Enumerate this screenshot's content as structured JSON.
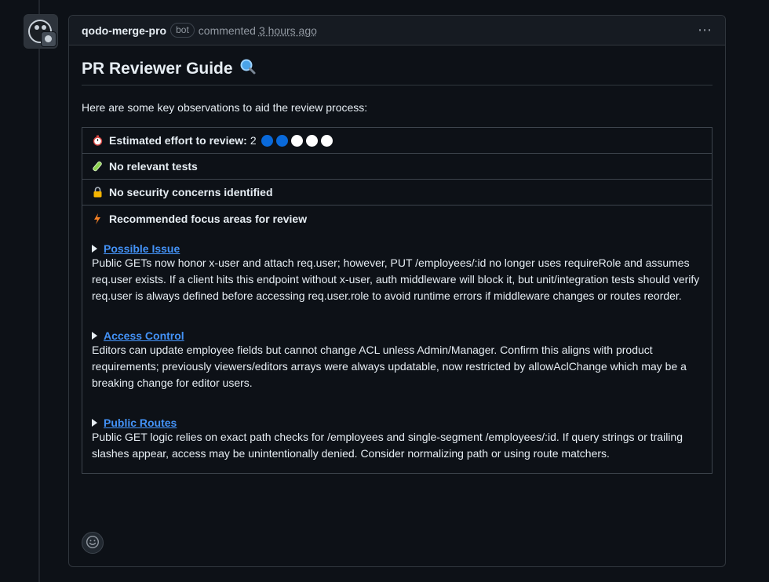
{
  "comment": {
    "author": "qodo-merge-pro",
    "badge": "bot",
    "action": "commented",
    "timestamp": "3 hours ago",
    "more_icon": "kebab-horizontal-icon"
  },
  "guide": {
    "title": "PR Reviewer Guide",
    "title_icon": "magnifier-icon",
    "intro": "Here are some key observations to aid the review process:",
    "effort": {
      "label": "Estimated effort to review:",
      "value": "2",
      "filled": 2,
      "total": 5,
      "filled_color": "#0969da",
      "empty_color": "#ffffff",
      "icon": "stopwatch-icon"
    },
    "tests": {
      "label": "No relevant tests",
      "icon": "test-tube-icon"
    },
    "security": {
      "label": "No security concerns identified",
      "icon": "lock-icon"
    },
    "focus": {
      "label": "Recommended focus areas for review",
      "icon": "lightning-icon",
      "items": [
        {
          "title": "Possible Issue",
          "text": "Public GETs now honor x-user and attach req.user; however, PUT /employees/:id no longer uses requireRole and assumes req.user exists. If a client hits this endpoint without x-user, auth middleware will block it, but unit/integration tests should verify req.user is always defined before accessing req.user.role to avoid runtime errors if middleware changes or routes reorder."
        },
        {
          "title": "Access Control",
          "text": "Editors can update employee fields but cannot change ACL unless Admin/Manager. Confirm this aligns with product requirements; previously viewers/editors arrays were always updatable, now restricted by allowAclChange which may be a breaking change for editor users."
        },
        {
          "title": "Public Routes",
          "text": "Public GET logic relies on exact path checks for /employees and single-segment /employees/:id. If query strings or trailing slashes appear, access may be unintentionally denied. Consider normalizing path or using route matchers."
        }
      ]
    }
  },
  "reactions": {
    "icon": "smiley-icon"
  },
  "colors": {
    "accent_link": "#4493f8",
    "background": "#0d1117",
    "border": "#30363d"
  }
}
